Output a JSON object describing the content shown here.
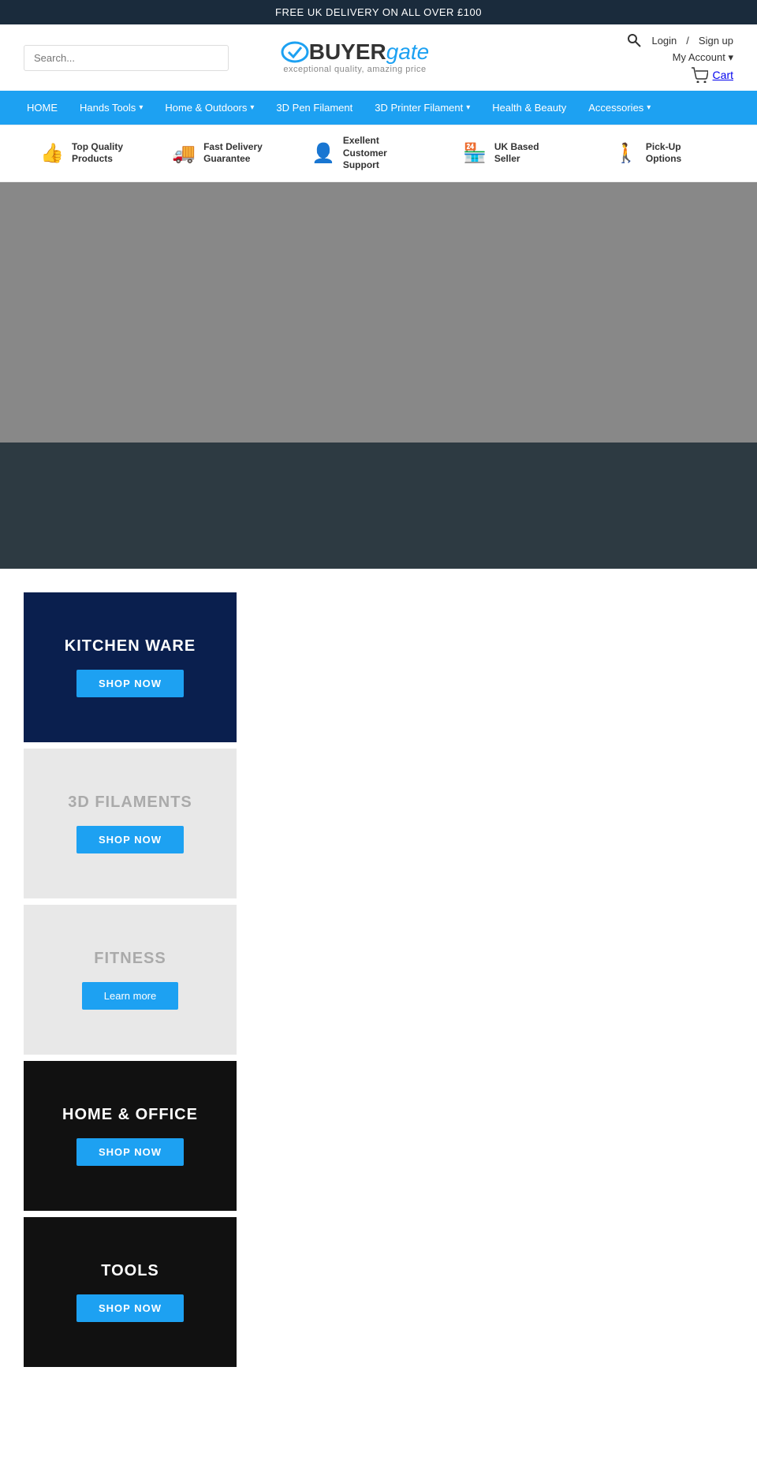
{
  "top_banner": {
    "text": "FREE UK DELIVERY ON ALL OVER £100"
  },
  "logo": {
    "buyer": "BUYER",
    "gate": "gate",
    "subtitle": "exceptional quality, amazing price"
  },
  "search": {
    "placeholder": "Search..."
  },
  "account": {
    "login": "Log",
    "signup": "nup",
    "my_account": "My A",
    "account_label": "nt",
    "cart": "Cart"
  },
  "nav": {
    "items": [
      {
        "label": "HOME",
        "has_dropdown": false
      },
      {
        "label": "Hands Tools",
        "has_dropdown": true
      },
      {
        "label": "Home & Outdoors",
        "has_dropdown": true
      },
      {
        "label": "3D Pen Filament",
        "has_dropdown": false
      },
      {
        "label": "3D Printer Filament",
        "has_dropdown": true
      },
      {
        "label": "Health & Beauty",
        "has_dropdown": false
      },
      {
        "label": "Accessories",
        "has_dropdown": true
      }
    ]
  },
  "features": [
    {
      "icon": "👍",
      "text": "Top Quality\nProducts"
    },
    {
      "icon": "🚚",
      "text": "Fast Delivery\nGuarantee"
    },
    {
      "icon": "👤",
      "text": "Exellent Customer\nSupport"
    },
    {
      "icon": "🏪",
      "text": "UK Based Seller"
    },
    {
      "icon": "🚶",
      "text": "Pick-Up Options"
    }
  ],
  "categories": [
    {
      "id": "kitchen",
      "title": "KITCHEN WARE",
      "btn_label": "SHOP NOW",
      "btn_type": "shop"
    },
    {
      "id": "filaments",
      "title": "3D FILAMENTS",
      "btn_label": "SHOP NOW",
      "btn_type": "shop"
    },
    {
      "id": "fitness",
      "title": "FITNESS",
      "btn_label": "Learn more",
      "btn_type": "learn"
    },
    {
      "id": "home-office",
      "title": "HOME & OFFICE",
      "btn_label": "SHOP NOW",
      "btn_type": "shop"
    },
    {
      "id": "tools",
      "title": "TOOLS",
      "btn_label": "SHOP NOW",
      "btn_type": "shop"
    }
  ]
}
